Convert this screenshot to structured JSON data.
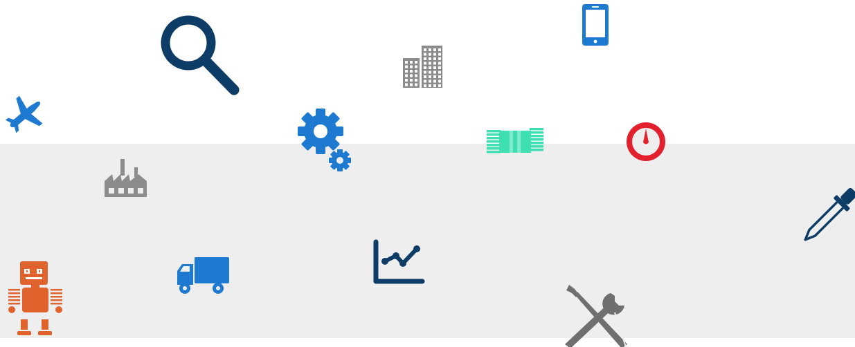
{
  "colors": {
    "background_top": "#ffffff",
    "background_band": "#eeeeee",
    "navy": "#0d3c66",
    "blue": "#1e7ad1",
    "gray": "#8c8c8c",
    "teal": "#3ee0b3",
    "red": "#e2212f",
    "orange": "#e0622d",
    "dark_gray": "#6f6f6f"
  },
  "icons": [
    "airplane-icon",
    "magnifier-icon",
    "gears-icon",
    "factory-icon",
    "buildings-icon",
    "smartphone-icon",
    "money-icon",
    "gauge-icon",
    "pipette-icon",
    "robot-icon",
    "truck-icon",
    "line-chart-icon",
    "tools-icon"
  ]
}
